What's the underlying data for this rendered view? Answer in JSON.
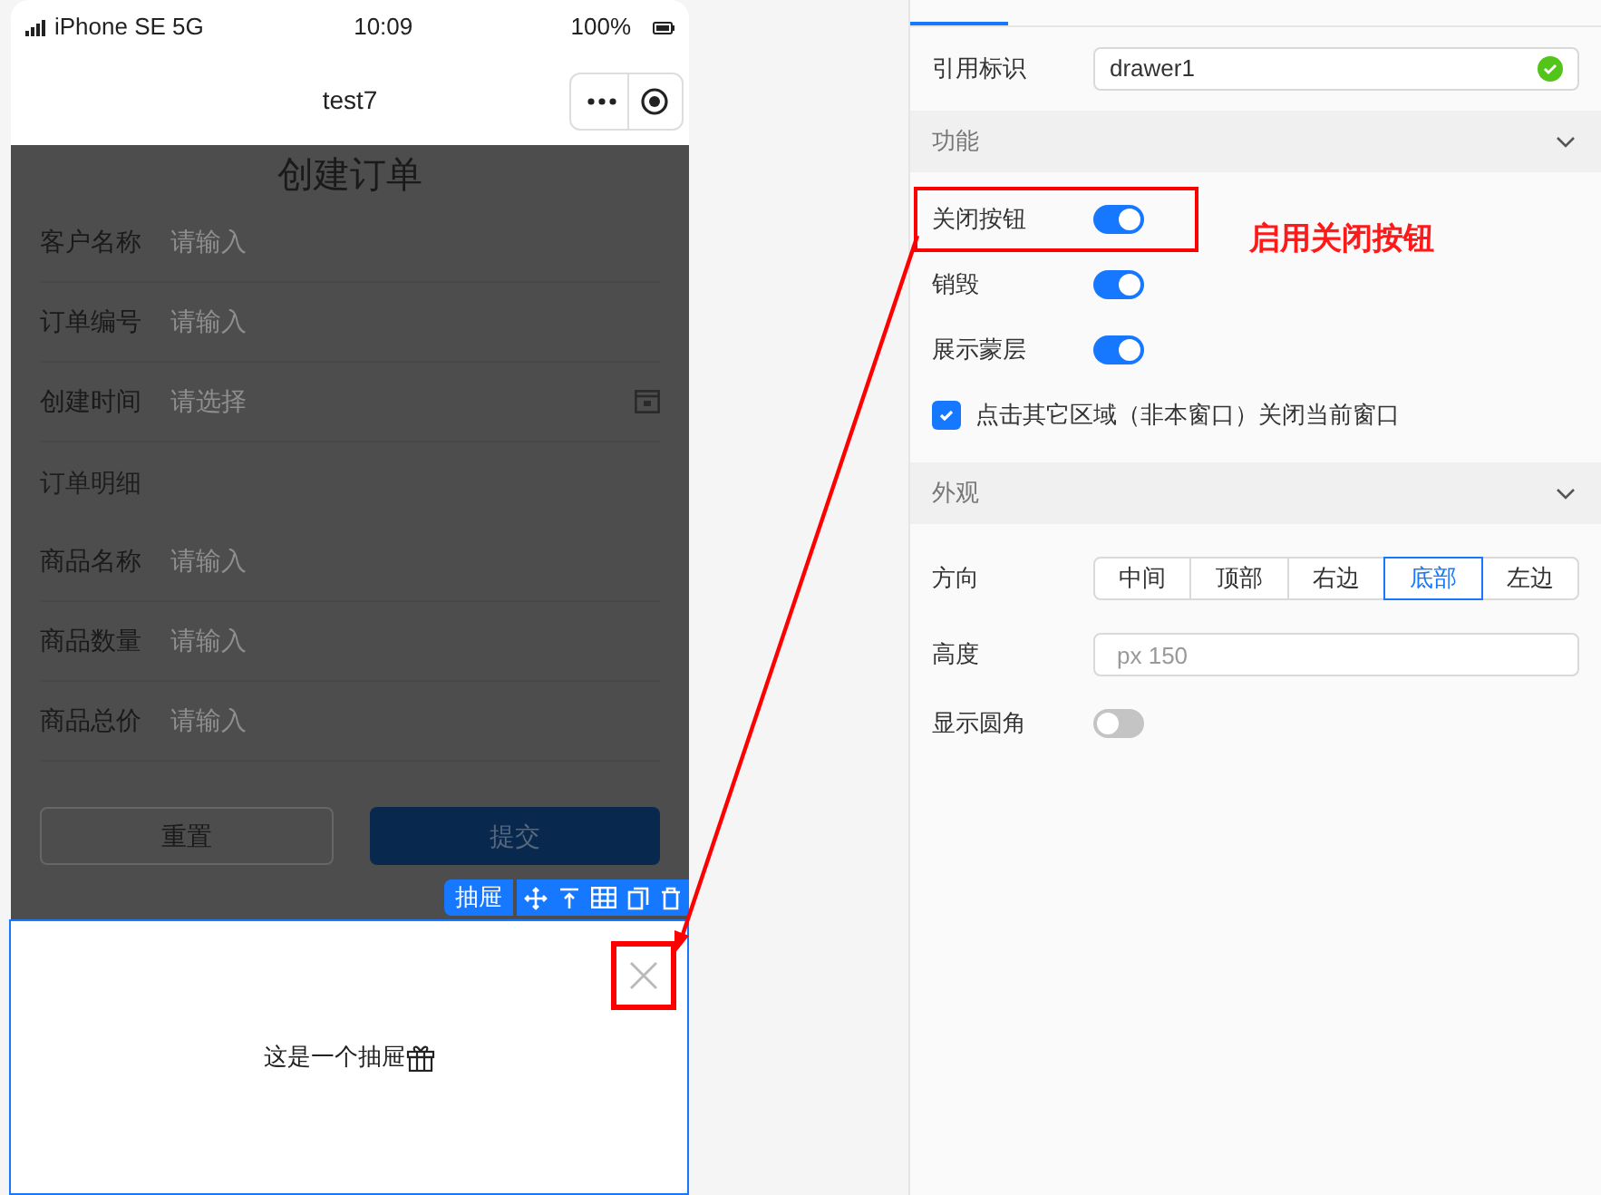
{
  "phone": {
    "status_bar": {
      "carrier": "iPhone SE 5G",
      "time": "10:09",
      "battery": "100%"
    },
    "nav_title": "test7",
    "page_title": "创建订单",
    "fields": [
      {
        "kind": "input",
        "label": "客户名称",
        "placeholder": "请输入"
      },
      {
        "kind": "input",
        "label": "订单编号",
        "placeholder": "请输入"
      },
      {
        "kind": "date",
        "label": "创建时间",
        "placeholder": "请选择"
      },
      {
        "kind": "section",
        "label": "订单明细"
      },
      {
        "kind": "input",
        "label": "商品名称",
        "placeholder": "请输入"
      },
      {
        "kind": "input",
        "label": "商品数量",
        "placeholder": "请输入"
      },
      {
        "kind": "input",
        "label": "商品总价",
        "placeholder": "请输入"
      }
    ],
    "buttons": [
      {
        "kind": "secondary",
        "label": "重置"
      },
      {
        "kind": "primary",
        "label": "提交"
      }
    ],
    "selection_toolbar": {
      "label": "抽屉"
    },
    "drawer": {
      "text": "这是一个抽屉",
      "show_close": true
    }
  },
  "panel": {
    "ref_field": {
      "label": "引用标识",
      "value": "drawer1",
      "valid": true
    },
    "sections": [
      {
        "title": "功能",
        "expanded": true,
        "items": [
          {
            "kind": "switch",
            "label": "关闭按钮",
            "on": true,
            "highlighted": true
          },
          {
            "kind": "switch",
            "label": "销毁",
            "on": true,
            "highlighted": false
          },
          {
            "kind": "switch",
            "label": "展示蒙层",
            "on": true,
            "highlighted": false
          },
          {
            "kind": "checkbox",
            "label": "点击其它区域（非本窗口）关闭当前窗口",
            "checked": true
          }
        ]
      },
      {
        "title": "外观",
        "expanded": true,
        "items": [
          {
            "kind": "segmented",
            "label": "方向",
            "options": [
              {
                "label": "中间",
                "selected": false
              },
              {
                "label": "顶部",
                "selected": false
              },
              {
                "label": "右边",
                "selected": false
              },
              {
                "label": "底部",
                "selected": true
              },
              {
                "label": "左边",
                "selected": false
              }
            ]
          },
          {
            "kind": "input",
            "label": "高度",
            "placeholder": "px 150"
          },
          {
            "kind": "switch",
            "label": "显示圆角",
            "on": false,
            "highlighted": false
          }
        ]
      }
    ]
  },
  "annotation": {
    "text": "启用关闭按钮"
  }
}
